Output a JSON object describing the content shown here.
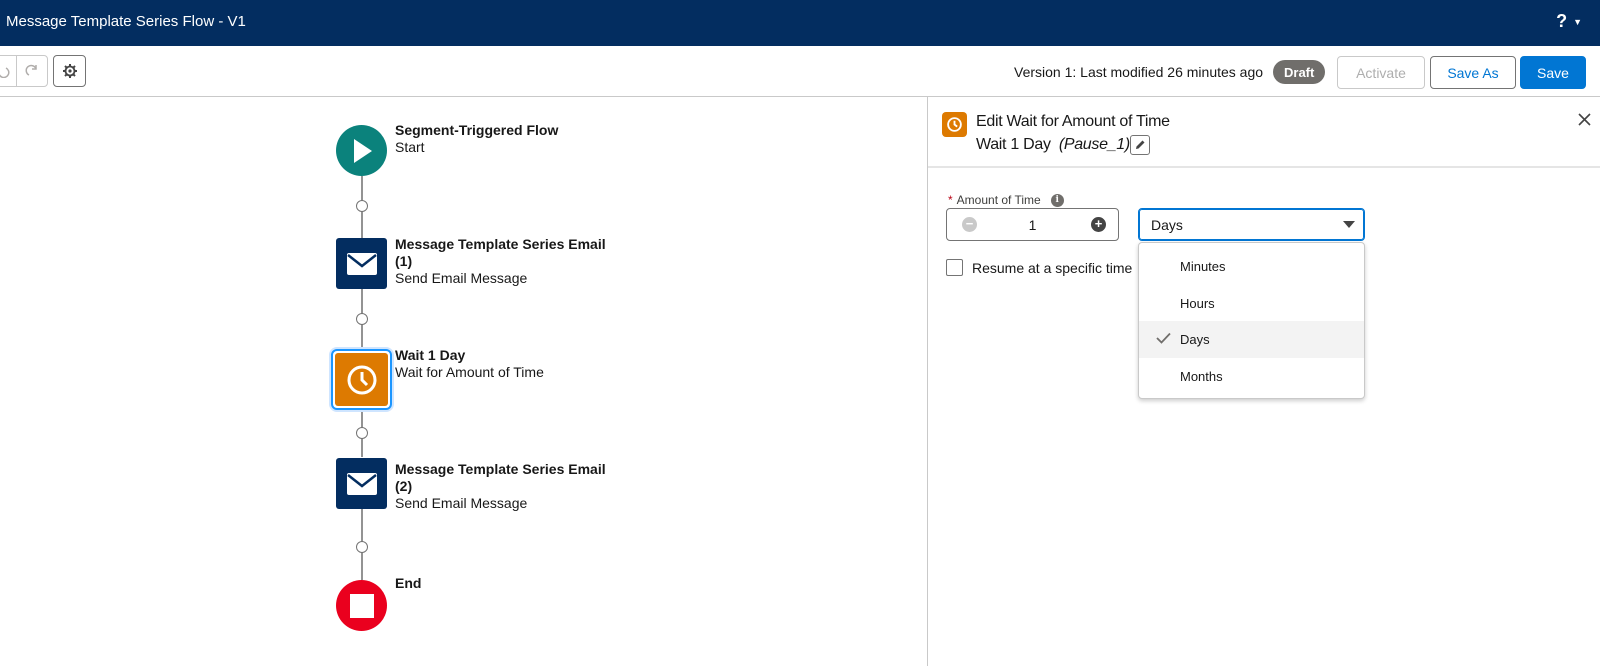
{
  "header": {
    "title": "Message Template Series Flow - V1",
    "help_label": "?"
  },
  "toolbar": {
    "version_text": "Version 1: Last modified 26 minutes ago",
    "status_badge": "Draft",
    "activate_label": "Activate",
    "save_as_label": "Save As",
    "save_label": "Save"
  },
  "flow": {
    "nodes": [
      {
        "title": "Segment-Triggered Flow",
        "subtitle": "Start",
        "icon": "play-icon"
      },
      {
        "title": "Message Template Series Email (1)",
        "subtitle": "Send Email Message",
        "icon": "email-icon"
      },
      {
        "title": "Wait 1 Day",
        "subtitle": "Wait for Amount of Time",
        "icon": "clock-icon"
      },
      {
        "title": "Message Template Series Email (2)",
        "subtitle": "Send Email Message",
        "icon": "email-icon"
      },
      {
        "title": "End",
        "subtitle": "",
        "icon": "stop-icon"
      }
    ]
  },
  "panel": {
    "title": "Edit Wait for Amount of Time",
    "element_label": "Wait 1 Day",
    "api_name": "(Pause_1)",
    "amount_label": "Amount of Time",
    "required_mark": "*",
    "amount_value": "1",
    "unit_value": "Days",
    "resume_label": "Resume at a specific time",
    "unit_options": [
      "Minutes",
      "Hours",
      "Days",
      "Months"
    ]
  },
  "colors": {
    "header_bg": "#032d60",
    "brand_blue": "#0176d3",
    "start_green": "#0b827c",
    "wait_orange": "#dd7a01",
    "end_red": "#ea001e"
  }
}
